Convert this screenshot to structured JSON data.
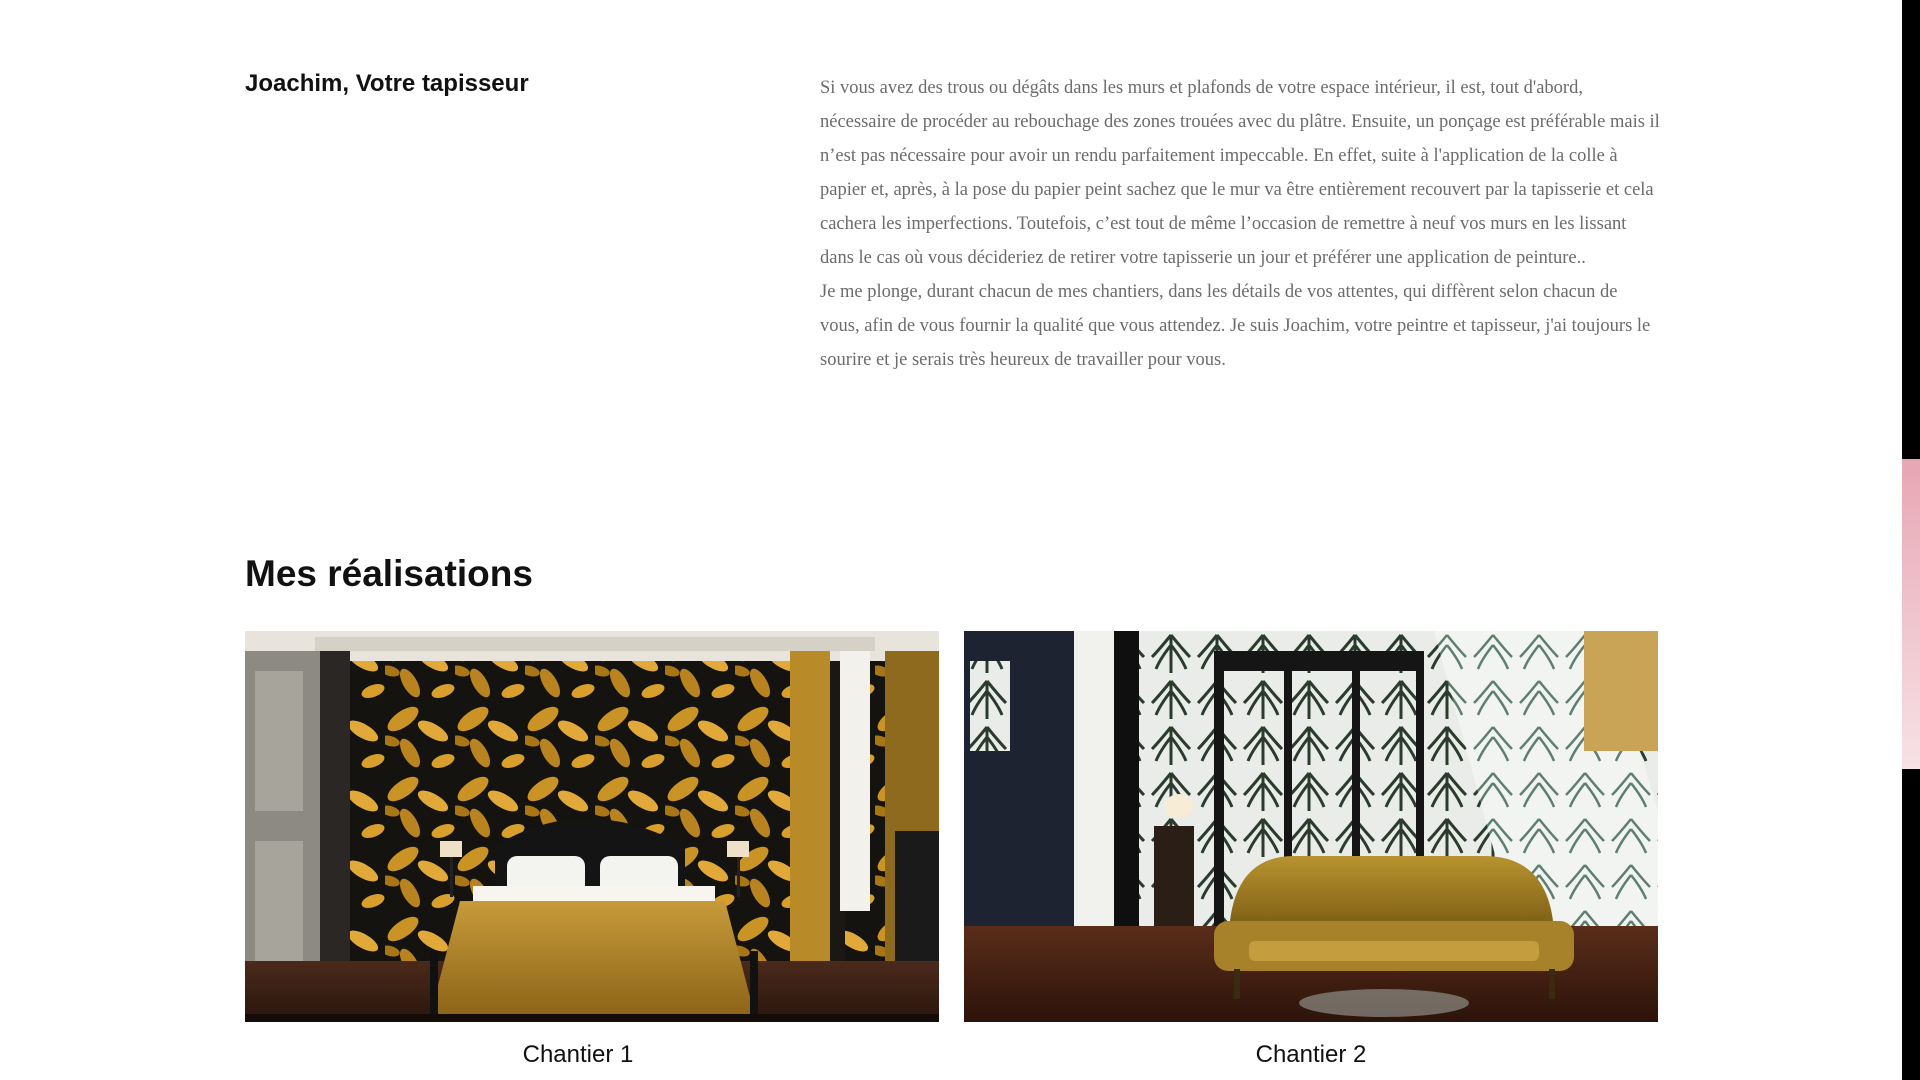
{
  "about": {
    "title": "Joachim, Votre tapisseur",
    "paragraphs": [
      "Si vous avez des trous ou dégâts dans les murs et plafonds de votre espace intérieur, il est, tout d'abord, nécessaire de procéder au rebouchage des zones trouées avec du plâtre. Ensuite, un ponçage est préférable mais il n’est pas nécessaire pour avoir un rendu parfaitement impeccable. En effet, suite à l'application de la colle à papier et, après, à la pose du papier peint sachez que le mur va être entièrement recouvert par la tapisserie et cela cachera les imperfections. Toutefois, c’est tout de même l’occasion de remettre à neuf vos murs en les lissant dans le cas où vous décideriez de retirer votre tapisserie un jour et préférer une application de peinture..",
      "Je me plonge, durant chacun de mes chantiers, dans les détails de vos attentes, qui diffèrent selon chacun de vous, afin de vous fournir la qualité que vous attendez. Je suis Joachim, votre peintre et tapisseur, j'ai toujours le sourire et je serais très heureux de travailler pour vous."
    ]
  },
  "gallery": {
    "title": "Mes réalisations",
    "items": [
      {
        "caption": "Chantier 1"
      },
      {
        "caption": "Chantier 2"
      }
    ]
  },
  "colors": {
    "heading": "#111111",
    "body_text": "#6b6b6b",
    "background": "#ffffff",
    "scrollbar_track": "#000000",
    "scrollbar_thumb": "#eeb9c4"
  }
}
